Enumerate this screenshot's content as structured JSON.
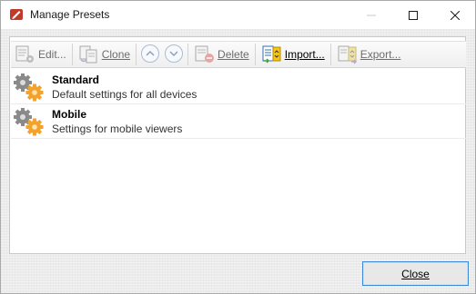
{
  "window": {
    "title": "Manage Presets"
  },
  "toolbar": {
    "edit_label": "Edit...",
    "clone_label": "Clone",
    "delete_label": "Delete",
    "import_label": "Import...",
    "export_label": "Export..."
  },
  "presets": [
    {
      "name": "Standard",
      "description": "Default settings for all devices"
    },
    {
      "name": "Mobile",
      "description": "Settings for mobile viewers"
    }
  ],
  "footer": {
    "close_label": "Close"
  },
  "colors": {
    "accent": "#3c8ad8",
    "gear_gray": "#7b7b7b",
    "gear_orange": "#f3a22a",
    "app_icon_red": "#c0392b"
  },
  "icons": {
    "app": "pdf-red-pen-icon",
    "edit": "edit-preset-icon",
    "clone": "clone-preset-icon",
    "move_up": "move-up-icon",
    "move_down": "move-down-icon",
    "delete": "delete-preset-icon",
    "import": "import-preset-icon",
    "export": "export-preset-icon",
    "preset": "gears-icon"
  }
}
